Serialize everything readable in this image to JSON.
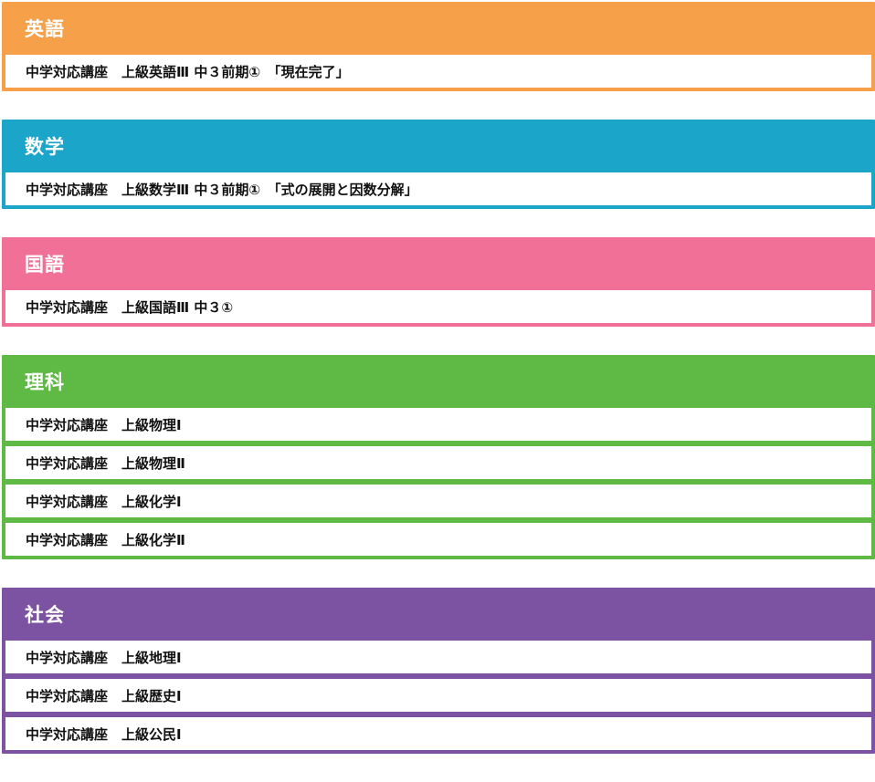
{
  "sections": [
    {
      "id": "english",
      "title": "英語",
      "color": "#f7a04a",
      "items": [
        "中学対応講座　上級英語Ⅲ 中３前期①　「現在完了」"
      ]
    },
    {
      "id": "math",
      "title": "数学",
      "color": "#1aa5c9",
      "items": [
        "中学対応講座　上級数学Ⅲ 中３前期①　「式の展開と因数分解」"
      ]
    },
    {
      "id": "japanese",
      "title": "国語",
      "color": "#f07097",
      "items": [
        "中学対応講座　上級国語Ⅲ 中３①"
      ]
    },
    {
      "id": "science",
      "title": "理科",
      "color": "#5fba45",
      "items": [
        "中学対応講座　上級物理Ⅰ",
        "中学対応講座　上級物理Ⅱ",
        "中学対応講座　上級化学Ⅰ",
        "中学対応講座　上級化学Ⅱ"
      ]
    },
    {
      "id": "social",
      "title": "社会",
      "color": "#7c53a3",
      "items": [
        "中学対応講座　上級地理Ⅰ",
        "中学対応講座　上級歴史Ⅰ",
        "中学対応講座　上級公民Ⅰ"
      ]
    }
  ]
}
